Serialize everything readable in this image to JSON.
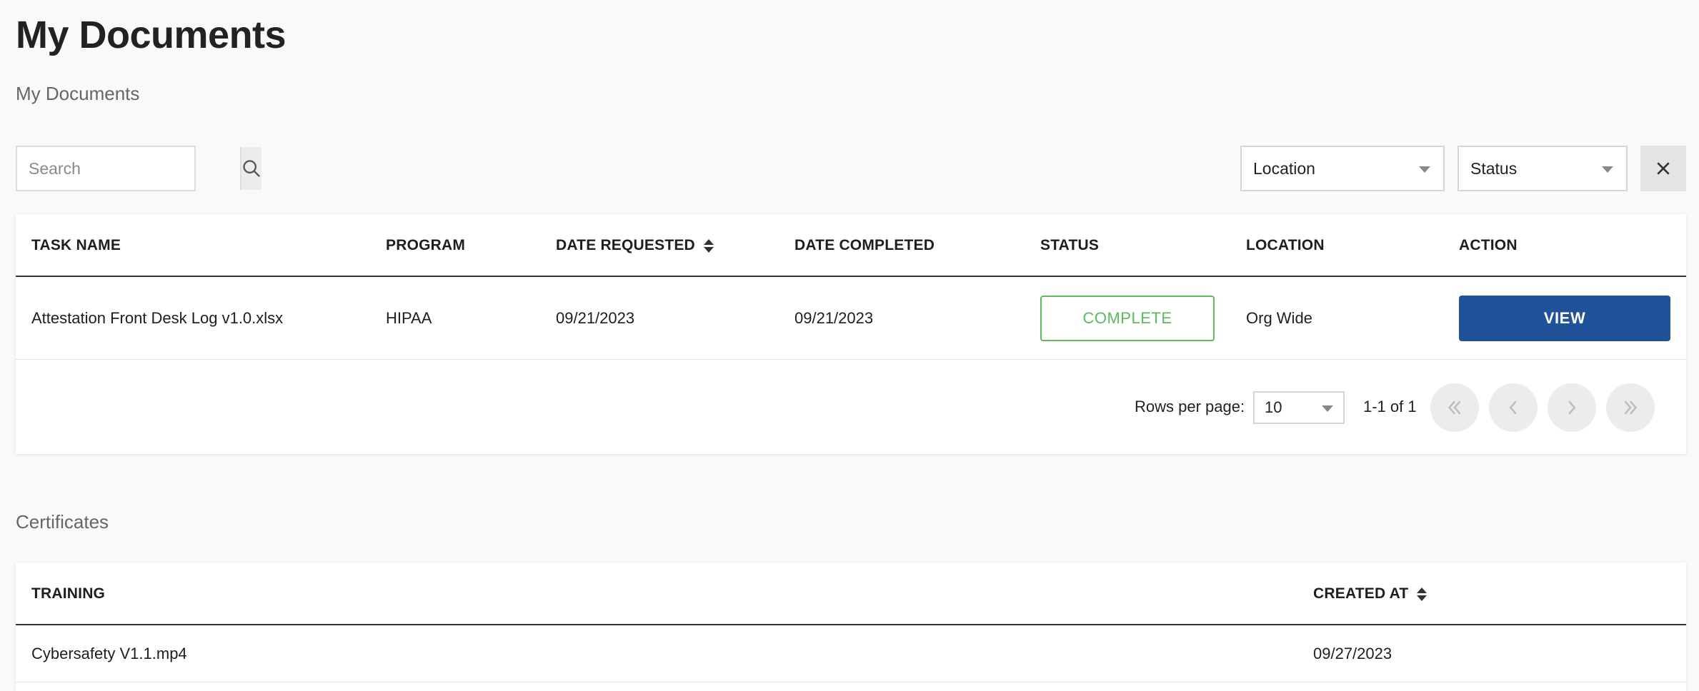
{
  "page": {
    "title": "My Documents"
  },
  "documents_section": {
    "title": "My Documents",
    "search": {
      "placeholder": "Search",
      "value": ""
    },
    "filters": {
      "location": "Location",
      "status": "Status"
    },
    "table": {
      "headers": {
        "task_name": "TASK NAME",
        "program": "PROGRAM",
        "date_requested": "DATE REQUESTED",
        "date_completed": "DATE COMPLETED",
        "status": "STATUS",
        "location": "LOCATION",
        "action": "ACTION"
      },
      "rows": [
        {
          "task_name": "Attestation Front Desk Log v1.0.xlsx",
          "program": "HIPAA",
          "date_requested": "09/21/2023",
          "date_completed": "09/21/2023",
          "status": "COMPLETE",
          "location": "Org Wide",
          "action": "VIEW"
        }
      ]
    },
    "pagination": {
      "rows_per_page_label": "Rows per page:",
      "rows_per_page": "10",
      "range": "1-1 of 1"
    }
  },
  "certificates_section": {
    "title": "Certificates",
    "headers": {
      "training": "TRAINING",
      "created_at": "CREATED AT"
    },
    "rows": [
      {
        "training": "Cybersafety V1.1.mp4",
        "created_at": "09/27/2023"
      }
    ]
  },
  "colors": {
    "primary": "#1f5299",
    "status_complete": "#5cba5c",
    "background": "#f9f9f9"
  },
  "icons": [
    "search-icon",
    "close-icon",
    "sort-icon",
    "chevron-down-icon",
    "first-page-icon",
    "prev-page-icon",
    "next-page-icon",
    "last-page-icon"
  ]
}
